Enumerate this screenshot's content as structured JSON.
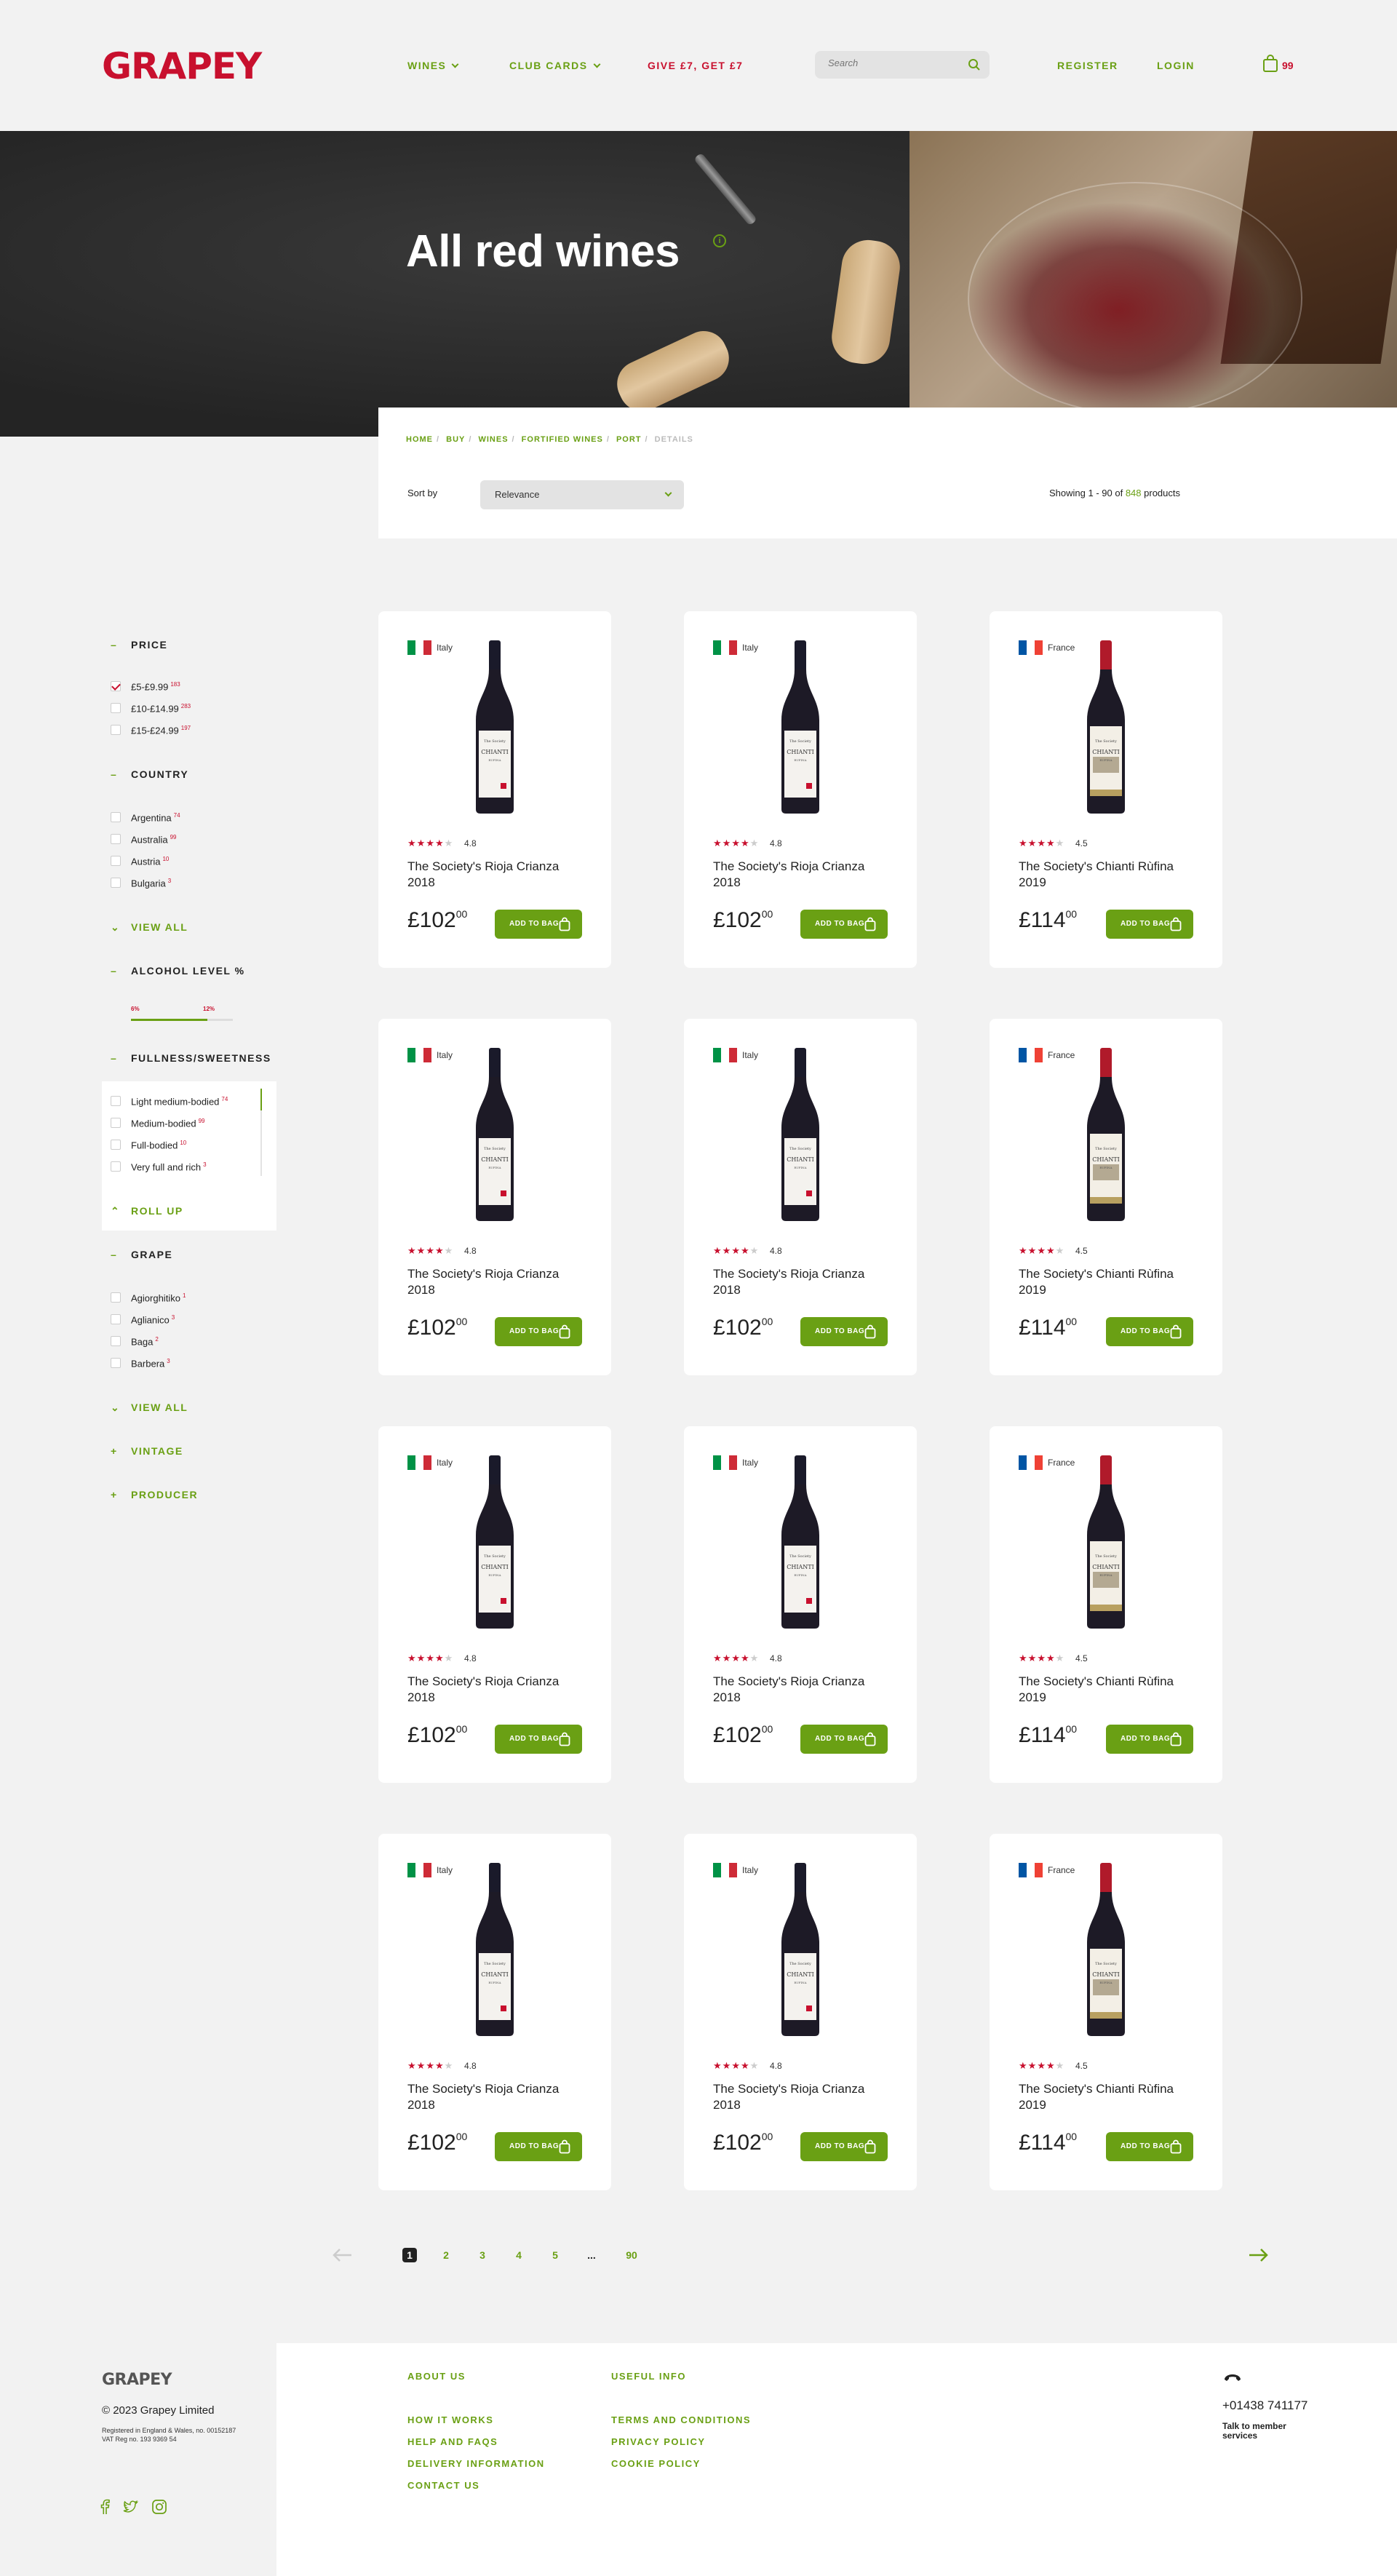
{
  "header": {
    "logo": "GRAPEY",
    "nav": {
      "wines": "WINES",
      "club_cards": "CLUB CARDS",
      "promo": "GIVE £7, GET £7"
    },
    "search_placeholder": "Search",
    "register": "REGISTER",
    "login": "LOGIN",
    "cart_count": "99"
  },
  "hero": {
    "title": "All red wines",
    "info": "i"
  },
  "breadcrumb": [
    "HOME",
    "BUY",
    "WINES",
    "FORTIFIED WINES",
    "PORT",
    "DETAILS"
  ],
  "sort": {
    "label": "Sort by",
    "value": "Relevance"
  },
  "showing": {
    "prefix": "Showing 1 - 90 of",
    "count": "848",
    "suffix": "products"
  },
  "filters": {
    "price": {
      "title": "PRICE",
      "options": [
        {
          "label": "£5-£9.99",
          "count": "183",
          "checked": true
        },
        {
          "label": "£10-£14.99",
          "count": "283",
          "checked": false
        },
        {
          "label": "£15-£24.99",
          "count": "197",
          "checked": false
        }
      ]
    },
    "country": {
      "title": "COUNTRY",
      "options": [
        {
          "label": "Argentina",
          "count": "74"
        },
        {
          "label": "Australia",
          "count": "99"
        },
        {
          "label": "Austria",
          "count": "10"
        },
        {
          "label": "Bulgaria",
          "count": "3"
        }
      ],
      "view_all": "VIEW ALL"
    },
    "alcohol": {
      "title": "ALCOHOL LEVEL %",
      "low": "6%",
      "high": "12%",
      "low_value": 6,
      "high_value": 12
    },
    "fullness": {
      "title": "FULLNESS/SWEETNESS",
      "options": [
        {
          "label": "Light medium-bodied",
          "count": "74"
        },
        {
          "label": "Medium-bodied",
          "count": "99"
        },
        {
          "label": "Full-bodied",
          "count": "10"
        },
        {
          "label": "Very full and rich",
          "count": "3"
        }
      ],
      "roll_up": "ROLL UP"
    },
    "grape": {
      "title": "GRAPE",
      "options": [
        {
          "label": "Agiorghitiko",
          "count": "1"
        },
        {
          "label": "Aglianico",
          "count": "3"
        },
        {
          "label": "Baga",
          "count": "2"
        },
        {
          "label": "Barbera",
          "count": "3"
        }
      ],
      "view_all": "VIEW ALL"
    },
    "vintage": {
      "title": "VINTAGE"
    },
    "producer": {
      "title": "PRODUCER"
    }
  },
  "products": [
    {
      "country": "Italy",
      "flag": "italy",
      "rating": "4.8",
      "stars": 4,
      "name": "The Society's Rioja Crianza 2018",
      "price": "£102",
      "pence": "00",
      "button": "ADD TO BAG"
    },
    {
      "country": "Italy",
      "flag": "italy",
      "rating": "4.8",
      "stars": 4,
      "name": "The Society's Rioja Crianza 2018",
      "price": "£102",
      "pence": "00",
      "button": "ADD TO BAG"
    },
    {
      "country": "France",
      "flag": "france",
      "rating": "4.5",
      "stars": 4,
      "name": "The Society's Chianti Rùfina 2019",
      "price": "£114",
      "pence": "00",
      "button": "ADD TO BAG"
    },
    {
      "country": "Italy",
      "flag": "italy",
      "rating": "4.8",
      "stars": 4,
      "name": "The Society's Rioja Crianza 2018",
      "price": "£102",
      "pence": "00",
      "button": "ADD TO BAG"
    },
    {
      "country": "Italy",
      "flag": "italy",
      "rating": "4.8",
      "stars": 4,
      "name": "The Society's Rioja Crianza 2018",
      "price": "£102",
      "pence": "00",
      "button": "ADD TO BAG"
    },
    {
      "country": "France",
      "flag": "france",
      "rating": "4.5",
      "stars": 4,
      "name": "The Society's Chianti Rùfina 2019",
      "price": "£114",
      "pence": "00",
      "button": "ADD TO BAG"
    },
    {
      "country": "Italy",
      "flag": "italy",
      "rating": "4.8",
      "stars": 4,
      "name": "The Society's Rioja Crianza 2018",
      "price": "£102",
      "pence": "00",
      "button": "ADD TO BAG"
    },
    {
      "country": "Italy",
      "flag": "italy",
      "rating": "4.8",
      "stars": 4,
      "name": "The Society's Rioja Crianza 2018",
      "price": "£102",
      "pence": "00",
      "button": "ADD TO BAG"
    },
    {
      "country": "France",
      "flag": "france",
      "rating": "4.5",
      "stars": 4,
      "name": "The Society's Chianti Rùfina 2019",
      "price": "£114",
      "pence": "00",
      "button": "ADD TO BAG"
    },
    {
      "country": "Italy",
      "flag": "italy",
      "rating": "4.8",
      "stars": 4,
      "name": "The Society's Rioja Crianza 2018",
      "price": "£102",
      "pence": "00",
      "button": "ADD TO BAG"
    },
    {
      "country": "Italy",
      "flag": "italy",
      "rating": "4.8",
      "stars": 4,
      "name": "The Society's Rioja Crianza 2018",
      "price": "£102",
      "pence": "00",
      "button": "ADD TO BAG"
    },
    {
      "country": "France",
      "flag": "france",
      "rating": "4.5",
      "stars": 4,
      "name": "The Society's Chianti Rùfina 2019",
      "price": "£114",
      "pence": "00",
      "button": "ADD TO BAG"
    }
  ],
  "bottle_label": {
    "line1": "The Society",
    "line2": "CHIANTI",
    "line3": "RUFINA"
  },
  "pagination": {
    "pages": [
      "1",
      "2",
      "3",
      "4",
      "5",
      "...",
      "90"
    ],
    "current": "1"
  },
  "footer": {
    "logo": "GRAPEY",
    "copyright": "© 2023 Grapey Limited",
    "registered": "Registered in England & Wales, no. 00152187",
    "vat": "VAT Reg no. 193 9369 54",
    "about_title": "ABOUT US",
    "about_links": [
      "HOW IT WORKS",
      "HELP AND FAQS",
      "DELIVERY INFORMATION",
      "CONTACT US"
    ],
    "useful_title": "USEFUL INFO",
    "useful_links": [
      "TERMS AND CONDITIONS",
      "PRIVACY POLICY",
      "COOKIE POLICY"
    ],
    "phone": "+01438 741177",
    "talk": "Talk to member services",
    "social": [
      "facebook-icon",
      "twitter-icon",
      "instagram-icon"
    ]
  },
  "colors": {
    "accent": "#6aa014",
    "brand": "#c8102e",
    "background": "#f2f2f2"
  }
}
